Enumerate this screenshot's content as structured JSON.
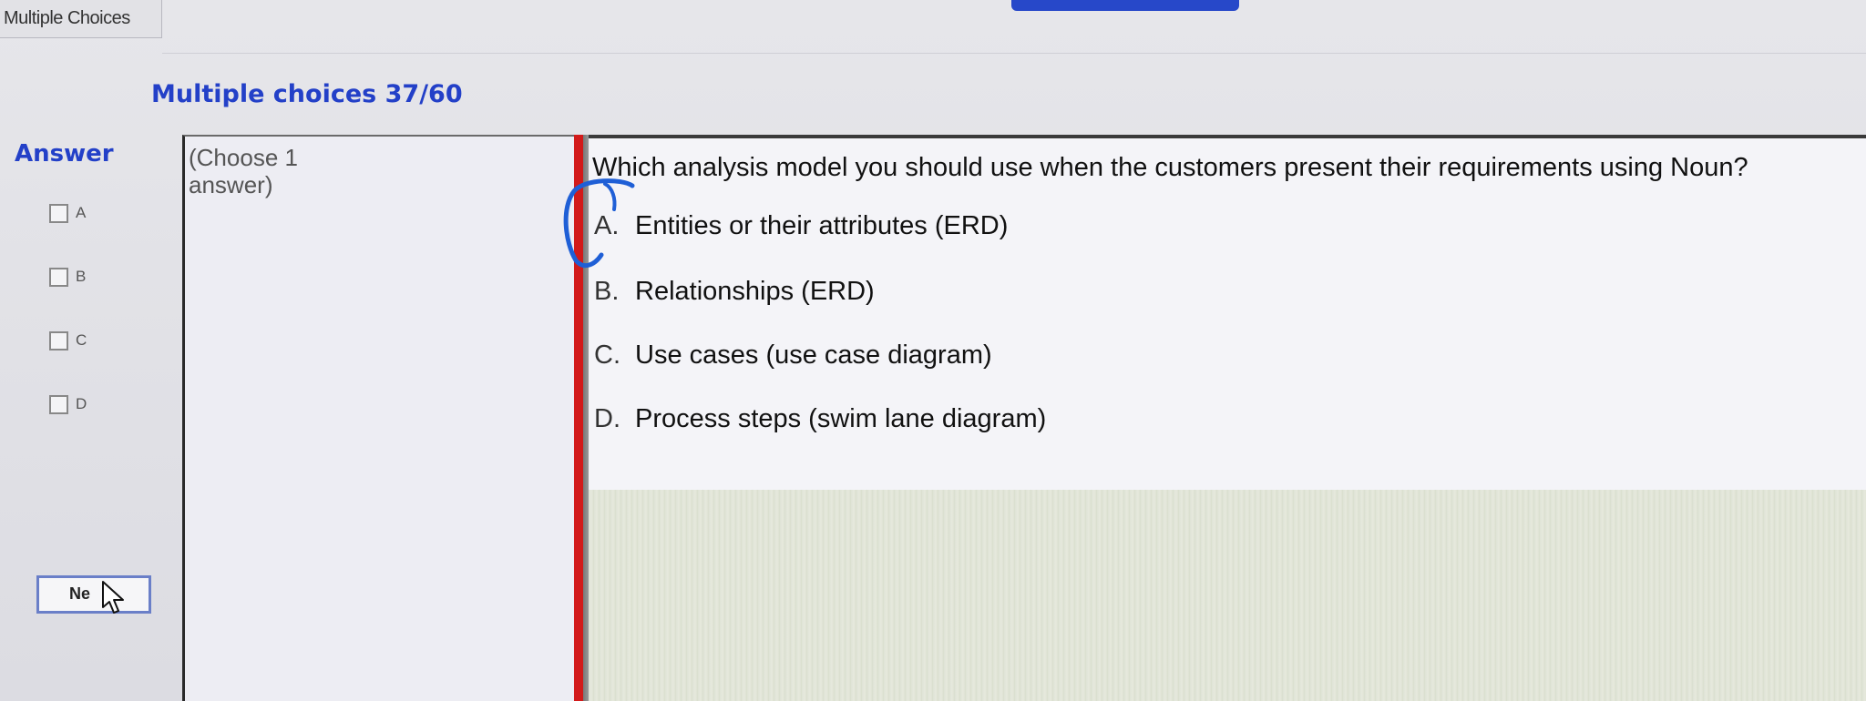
{
  "window": {
    "tab_title": "Multiple Choices"
  },
  "header": {
    "title": "Multiple choices 37/60"
  },
  "answer_panel": {
    "title": "Answer",
    "choices": [
      {
        "letter": "A"
      },
      {
        "letter": "B"
      },
      {
        "letter": "C"
      },
      {
        "letter": "D"
      }
    ],
    "next_button": "Ne"
  },
  "instructions": {
    "line1": "(Choose 1",
    "line2": "answer)"
  },
  "question": {
    "text": "Which analysis model you should use when the customers present their requirements using Noun?",
    "options": [
      {
        "letter": "A.",
        "text": "Entities or their attributes (ERD)"
      },
      {
        "letter": "B.",
        "text": "Relationships (ERD)"
      },
      {
        "letter": "C.",
        "text": "Use cases (use case diagram)"
      },
      {
        "letter": "D.",
        "text": "Process steps (swim lane diagram)"
      }
    ]
  },
  "colors": {
    "accent_blue": "#2340c8",
    "divider_red": "#d21a1a",
    "annotation_blue": "#1f5fd6"
  },
  "icons": [
    "checkbox-icon",
    "mouse-cursor-icon",
    "hand-drawn-circle"
  ]
}
